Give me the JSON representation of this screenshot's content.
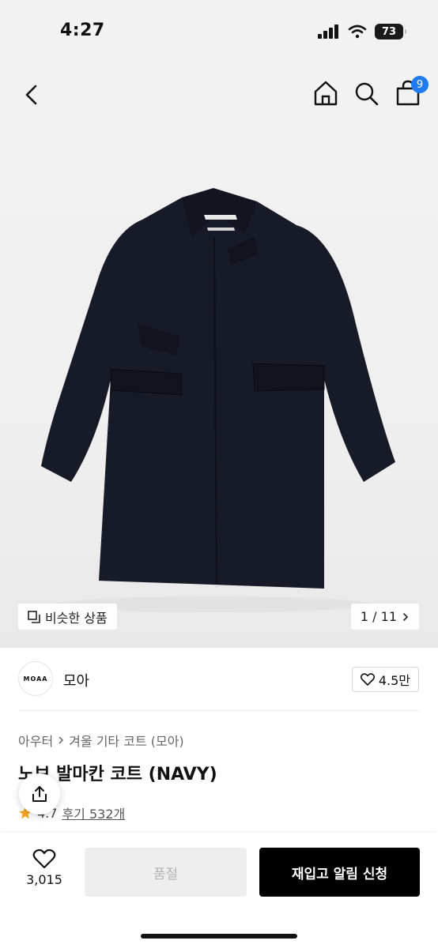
{
  "status_bar": {
    "time": "4:27",
    "battery": "73",
    "icons": [
      "signal-icon",
      "wifi-icon",
      "battery-icon"
    ]
  },
  "nav": {
    "back_icon": "back-chevron-icon",
    "home_icon": "home-icon",
    "search_icon": "search-icon",
    "cart_icon": "cart-icon",
    "cart_badge": "9"
  },
  "gallery": {
    "similar_label": "비슷한 상품",
    "pager": "1 / 11"
  },
  "brand": {
    "logo_text": "MOAA",
    "name": "모아",
    "likes": "4.5만"
  },
  "product": {
    "breadcrumb": [
      "아우터",
      "겨울 기타 코트 (모아)"
    ],
    "title": "노브 발마칸 코트 (NAVY)",
    "rating": "4.7",
    "reviews": "후기 532개"
  },
  "bottom_bar": {
    "wish_count": "3,015",
    "soldout_label": "품절",
    "restock_label": "재입고 알림 신청"
  },
  "colors": {
    "accent_badge": "#1e7bf0",
    "primary_button": "#000000",
    "disabled_button": "#eeeeee",
    "star": "#f5a623"
  }
}
